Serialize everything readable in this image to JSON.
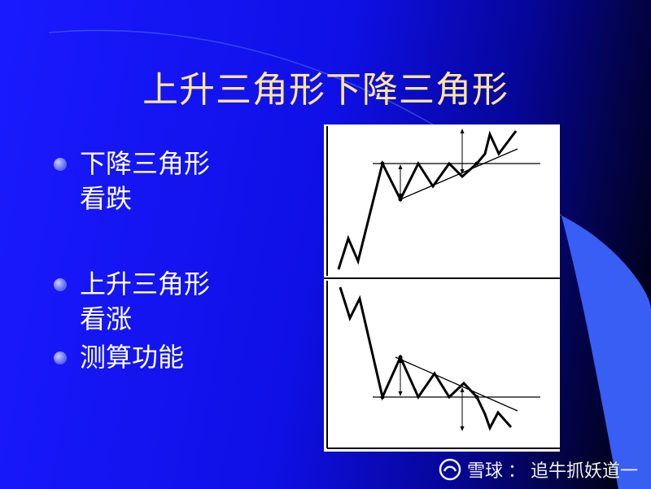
{
  "title": "上升三角形下降三角形",
  "bullets": [
    {
      "text": "下降三角形看跌"
    },
    {
      "text": "上升三角形看涨"
    },
    {
      "text": "测算功能"
    }
  ],
  "watermark": {
    "brand": "雪球",
    "separator": "：",
    "author": "追牛抓妖道一"
  },
  "colors": {
    "title": "#ffe79a",
    "text": "#ffffff",
    "background_start": "#1a1aff",
    "background_end": "#000000",
    "arc": "#3b63ff"
  }
}
